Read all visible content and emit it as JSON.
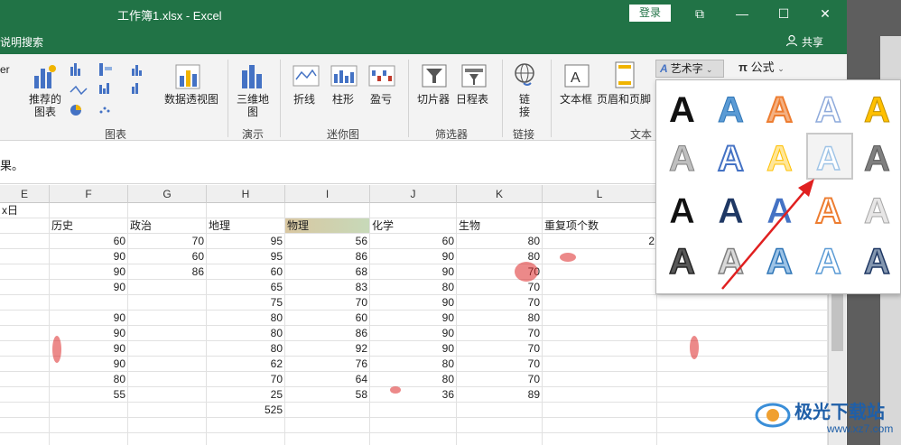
{
  "window": {
    "title": "工作簿1.xlsx  -  Excel",
    "login": "登录",
    "restore": "⧉",
    "minimize": "—",
    "maximize": "☐",
    "close": "✕"
  },
  "tellbar": {
    "tell_me": "说明搜索",
    "share": "共享"
  },
  "ribbon": {
    "groups": [
      {
        "label": "图表"
      },
      {
        "label": "演示"
      },
      {
        "label": "迷你图"
      },
      {
        "label": "筛选器"
      },
      {
        "label": "链接"
      },
      {
        "label": "文本"
      }
    ],
    "items": {
      "recommended_charts": "推荐的\n图表",
      "pivot_chart": "数据透视图",
      "map_3d": "三维地\n图",
      "line": "折线",
      "column": "柱形",
      "win_loss": "盈亏",
      "slicer": "切片器",
      "timeline": "日程表",
      "link": "链\n接",
      "textbox": "文本框",
      "header_footer": "页眉和页脚",
      "wordart": "艺术字",
      "equation": "公式",
      "left_partial": "er"
    }
  },
  "formula_bar": {
    "text": "果。"
  },
  "columns": [
    "E",
    "F",
    "G",
    "H",
    "I",
    "J",
    "K",
    "L"
  ],
  "sheet": {
    "row0": [
      "x日",
      "",
      "",
      "",
      "",
      "",
      "",
      ""
    ],
    "headers": [
      "",
      "历史",
      "政治",
      "地理",
      "物理",
      "化学",
      "生物",
      "重复项个数"
    ],
    "rows": [
      [
        "",
        "60",
        "70",
        "95",
        "56",
        "60",
        "80",
        "2"
      ],
      [
        "",
        "90",
        "60",
        "95",
        "86",
        "90",
        "80",
        ""
      ],
      [
        "",
        "90",
        "86",
        "60",
        "68",
        "90",
        "70",
        ""
      ],
      [
        "",
        "90",
        "",
        "65",
        "83",
        "80",
        "70",
        ""
      ],
      [
        "",
        "",
        "",
        "75",
        "70",
        "90",
        "70",
        ""
      ],
      [
        "",
        "90",
        "",
        "80",
        "60",
        "90",
        "80",
        ""
      ],
      [
        "",
        "90",
        "",
        "80",
        "86",
        "90",
        "70",
        ""
      ],
      [
        "",
        "90",
        "",
        "80",
        "92",
        "90",
        "70",
        ""
      ],
      [
        "",
        "90",
        "",
        "62",
        "76",
        "80",
        "70",
        ""
      ],
      [
        "",
        "80",
        "",
        "70",
        "64",
        "80",
        "70",
        ""
      ],
      [
        "",
        "55",
        "",
        "25",
        "58",
        "36",
        "89",
        ""
      ],
      [
        "",
        "",
        "",
        "525",
        "",
        "",
        "",
        ""
      ]
    ]
  },
  "wordart_styles": [
    "fill-black",
    "fill-blue-gradient",
    "fill-orange-outline",
    "outline-blue",
    "fill-gold",
    "fill-gray-gradient",
    "fill-blue-reflect",
    "fill-gold-soft",
    "outline-blue-selected",
    "fill-gray-dark",
    "fill-black-shadow",
    "fill-navy-bevel",
    "fill-blue-bevel",
    "outline-orange",
    "fill-light-gray",
    "pattern-dark",
    "pattern-gray",
    "pattern-blue",
    "pattern-blue-outline",
    "pattern-navy"
  ],
  "watermark": {
    "text": "极光下载站",
    "url": "www.xz7.com"
  },
  "colors": {
    "excel_green": "#217346",
    "accent_blue": "#4472c4"
  }
}
